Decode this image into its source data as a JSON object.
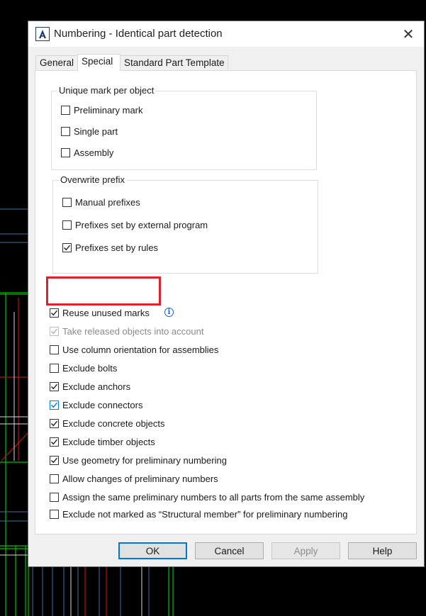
{
  "window": {
    "title": "Numbering - Identical part detection",
    "close_glyph": "✕",
    "app_icon": "autocad-logo-icon"
  },
  "tabs": [
    {
      "label": "General",
      "active": false
    },
    {
      "label": "Special",
      "active": true
    },
    {
      "label": "Standard Part Template",
      "active": false
    }
  ],
  "groups": {
    "unique_mark": {
      "title": "Unique mark per object",
      "options": [
        {
          "label": "Preliminary mark",
          "checked": false
        },
        {
          "label": "Single part",
          "checked": false
        },
        {
          "label": "Assembly",
          "checked": false
        }
      ]
    },
    "overwrite_prefix": {
      "title": "Overwrite prefix",
      "options": [
        {
          "label": "Manual prefixes",
          "checked": false
        },
        {
          "label": "Prefixes set by external program",
          "checked": false
        },
        {
          "label": "Prefixes set by rules",
          "checked": true
        }
      ]
    }
  },
  "options": [
    {
      "label": "Reuse unused marks",
      "checked": true,
      "highlighted": true,
      "info": true
    },
    {
      "label": "Take released objects into account",
      "checked": true,
      "disabled": true
    },
    {
      "label": "Use column orientation for assemblies",
      "checked": false
    },
    {
      "label": "Exclude bolts",
      "checked": false
    },
    {
      "label": "Exclude anchors",
      "checked": true
    },
    {
      "label": "Exclude connectors",
      "checked": true,
      "accent": true
    },
    {
      "label": "Exclude concrete objects",
      "checked": true
    },
    {
      "label": "Exclude timber objects",
      "checked": true
    },
    {
      "label": "Use geometry for preliminary numbering",
      "checked": true
    },
    {
      "label": "Allow changes of preliminary numbers",
      "checked": false
    },
    {
      "label": "Assign the same preliminary numbers to all parts from the same assembly",
      "checked": false
    },
    {
      "label": "Exclude not marked as “Structural member” for preliminary numbering",
      "checked": false
    }
  ],
  "info_glyph": "i",
  "buttons": {
    "ok": "OK",
    "cancel": "Cancel",
    "apply": "Apply",
    "help": "Help"
  },
  "colors": {
    "highlight": "#e0202c",
    "accent": "#0078d7",
    "cad_green": "#00c000",
    "cad_red": "#d01818"
  }
}
